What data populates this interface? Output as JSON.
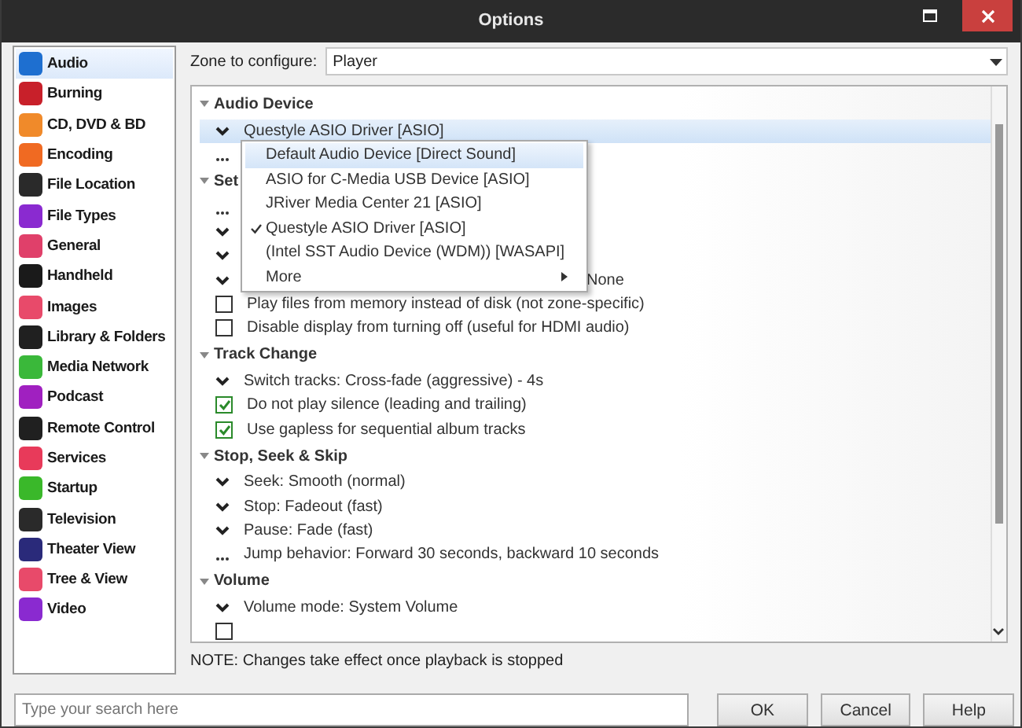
{
  "window": {
    "title": "Options"
  },
  "sidebar": {
    "items": [
      {
        "label": "Audio",
        "color": "#1e6fd0",
        "selected": true
      },
      {
        "label": "Burning",
        "color": "#c8202a",
        "selected": false
      },
      {
        "label": "CD, DVD & BD",
        "color": "#f08a2a",
        "selected": false
      },
      {
        "label": "Encoding",
        "color": "#f06a22",
        "selected": false
      },
      {
        "label": "File Location",
        "color": "#2a2a2a",
        "selected": false
      },
      {
        "label": "File Types",
        "color": "#8a2ad0",
        "selected": false
      },
      {
        "label": "General",
        "color": "#e0406a",
        "selected": false
      },
      {
        "label": "Handheld",
        "color": "#1a1a1a",
        "selected": false
      },
      {
        "label": "Images",
        "color": "#e84a6a",
        "selected": false
      },
      {
        "label": "Library & Folders",
        "color": "#202020",
        "selected": false
      },
      {
        "label": "Media Network",
        "color": "#3ab83a",
        "selected": false
      },
      {
        "label": "Podcast",
        "color": "#a020c0",
        "selected": false
      },
      {
        "label": "Remote Control",
        "color": "#202020",
        "selected": false
      },
      {
        "label": "Services",
        "color": "#e83a5a",
        "selected": false
      },
      {
        "label": "Startup",
        "color": "#3ab82a",
        "selected": false
      },
      {
        "label": "Television",
        "color": "#2a2a2a",
        "selected": false
      },
      {
        "label": "Theater View",
        "color": "#2a2a7a",
        "selected": false
      },
      {
        "label": "Tree & View",
        "color": "#e84a6a",
        "selected": false
      },
      {
        "label": "Video",
        "color": "#8a2ad0",
        "selected": false
      }
    ]
  },
  "zone": {
    "label": "Zone to configure:",
    "value": "Player"
  },
  "settings": {
    "sections": [
      {
        "title": "Audio Device",
        "expanded": true,
        "rows": [
          {
            "kind": "choice",
            "text": "Questyle ASIO Driver [ASIO]",
            "selected": true
          },
          {
            "kind": "more",
            "selected": false
          }
        ]
      },
      {
        "title": "Set",
        "expanded": true,
        "rows": [
          {
            "kind": "more",
            "selected": false
          },
          {
            "kind": "choice",
            "selected": false
          },
          {
            "kind": "choice",
            "selected": false
          },
          {
            "kind": "choice",
            "text": "None",
            "covered": true,
            "selected": false
          },
          {
            "kind": "checkbox",
            "text": "Play files from memory instead of disk (not zone-specific)",
            "checked": false,
            "selected": false
          },
          {
            "kind": "checkbox",
            "text": "Disable display from turning off (useful for HDMI audio)",
            "checked": false,
            "selected": false
          }
        ]
      },
      {
        "title": "Track Change",
        "expanded": true,
        "rows": [
          {
            "kind": "choice",
            "text": "Switch tracks: Cross-fade (aggressive) - 4s",
            "selected": false
          },
          {
            "kind": "checkbox",
            "text": "Do not play silence (leading and trailing)",
            "checked": true,
            "selected": false
          },
          {
            "kind": "checkbox",
            "text": "Use gapless for sequential album tracks",
            "checked": true,
            "selected": false
          }
        ]
      },
      {
        "title": "Stop, Seek & Skip",
        "expanded": true,
        "rows": [
          {
            "kind": "choice",
            "text": "Seek: Smooth (normal)",
            "selected": false
          },
          {
            "kind": "choice",
            "text": "Stop: Fadeout (fast)",
            "selected": false
          },
          {
            "kind": "choice",
            "text": "Pause: Fade (fast)",
            "selected": false
          },
          {
            "kind": "more",
            "text": "Jump behavior: Forward 30 seconds, backward 10 seconds",
            "selected": false
          }
        ]
      },
      {
        "title": "Volume",
        "expanded": true,
        "rows": [
          {
            "kind": "choice",
            "text": "Volume mode: System Volume",
            "selected": false
          },
          {
            "kind": "checkbox",
            "checked": false,
            "selected": false
          }
        ]
      }
    ]
  },
  "dropdown": {
    "items": [
      {
        "label": "Default Audio Device [Direct Sound]",
        "selected": true,
        "checked": false,
        "submenu": false
      },
      {
        "label": "ASIO for C-Media USB Device [ASIO]",
        "selected": false,
        "checked": false,
        "submenu": false
      },
      {
        "label": "JRiver Media Center 21 [ASIO]",
        "selected": false,
        "checked": false,
        "submenu": false
      },
      {
        "label": "Questyle ASIO Driver [ASIO]",
        "selected": false,
        "checked": true,
        "submenu": false
      },
      {
        "label": "(Intel SST Audio Device (WDM)) [WASAPI]",
        "selected": false,
        "checked": false,
        "submenu": false
      },
      {
        "label": "More",
        "selected": false,
        "checked": false,
        "submenu": true
      }
    ]
  },
  "note": "NOTE: Changes take effect once playback is stopped",
  "search": {
    "placeholder": "Type your search here"
  },
  "buttons": [
    "OK",
    "Cancel",
    "Help"
  ]
}
